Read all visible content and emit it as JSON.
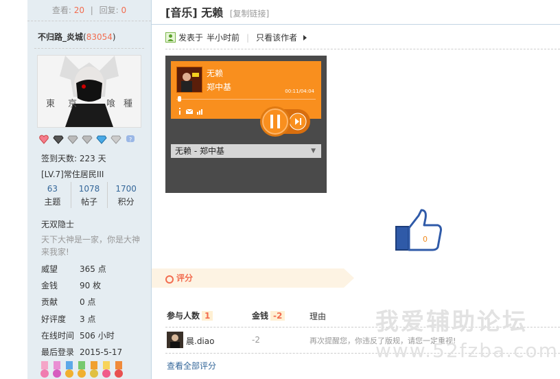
{
  "sidebar": {
    "views_label": "查看:",
    "views": "20",
    "replies_label": "回复:",
    "replies": "0",
    "username": "不归路_炎城",
    "uid": "83054",
    "avatar_text": [
      "東",
      "京",
      "喰",
      "種"
    ],
    "checkin": "签到天数: 223 天",
    "level": "[LV.7]常住居民III",
    "stats": [
      {
        "value": "63",
        "label": "主题"
      },
      {
        "value": "1078",
        "label": "帖子"
      },
      {
        "value": "1700",
        "label": "积分"
      }
    ],
    "custom_title": "无双隐士",
    "motto": "天下大神是一家，你是大神来我家!",
    "fields": [
      {
        "key": "威望",
        "value": "365 点"
      },
      {
        "key": "金钱",
        "value": "90 枚"
      },
      {
        "key": "贡献",
        "value": "0 点"
      },
      {
        "key": "好评度",
        "value": "3 点"
      },
      {
        "key": "在线时间",
        "value": "506 小时"
      },
      {
        "key": "最后登录",
        "value": "2015-5-17"
      }
    ]
  },
  "post": {
    "tag": "[音乐]",
    "title": "无赖",
    "copy_link": "[复制链接]",
    "posted_prefix": "发表于",
    "posted_time": "半小时前",
    "only_author": "只看该作者"
  },
  "player": {
    "song": "无赖",
    "artist": "郑中基",
    "time": "00:11/04:04",
    "playlist_item": "无赖 - 郑中基",
    "accent_color": "#f98f1e"
  },
  "like": {
    "count": "0"
  },
  "rating": {
    "section_label": "评分",
    "col_participants": "参与人数",
    "participants": "1",
    "col_money": "金钱",
    "money_total": "-2",
    "col_reason": "理由",
    "rows": [
      {
        "user": "晨.diao",
        "money": "-2",
        "reason": "再次提醒您，你违反了版规，请您一定重视!"
      }
    ],
    "view_all": "查看全部评分"
  },
  "watermark": {
    "line1": "我爱辅助论坛",
    "line2": "www.52fzba.com"
  }
}
